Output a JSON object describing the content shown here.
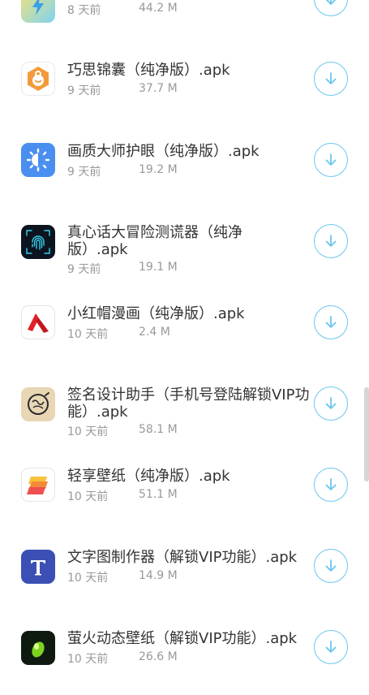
{
  "accent_color": "#6cc6ee",
  "items": [
    {
      "title": "",
      "time": "8 天前",
      "size": "44.2 M",
      "icon": "bolt-app-icon"
    },
    {
      "title": "巧思锦囊（纯净版）.apk",
      "time": "9 天前",
      "size": "37.7 M",
      "icon": "bag-app-icon"
    },
    {
      "title": "画质大师护眼（纯净版）.apk",
      "time": "9 天前",
      "size": "19.2 M",
      "icon": "sun-eye-app-icon"
    },
    {
      "title": "真心话大冒险测谎器（纯净版）.apk",
      "time": "9 天前",
      "size": "19.1 M",
      "icon": "fingerprint-app-icon"
    },
    {
      "title": "小红帽漫画（纯净版）.apk",
      "time": "10 天前",
      "size": "2.4 M",
      "icon": "red-hat-app-icon"
    },
    {
      "title": "签名设计助手（手机号登陆解锁VIP功能）.apk",
      "time": "10 天前",
      "size": "58.1 M",
      "icon": "signature-app-icon"
    },
    {
      "title": "轻享壁纸（纯净版）.apk",
      "time": "10 天前",
      "size": "51.1 M",
      "icon": "wallpaper-app-icon"
    },
    {
      "title": "文字图制作器（解锁VIP功能）.apk",
      "time": "10 天前",
      "size": "14.9 M",
      "icon": "letter-t-app-icon"
    },
    {
      "title": "萤火动态壁纸（解锁VIP功能）.apk",
      "time": "10 天前",
      "size": "26.6 M",
      "icon": "firefly-app-icon"
    }
  ]
}
